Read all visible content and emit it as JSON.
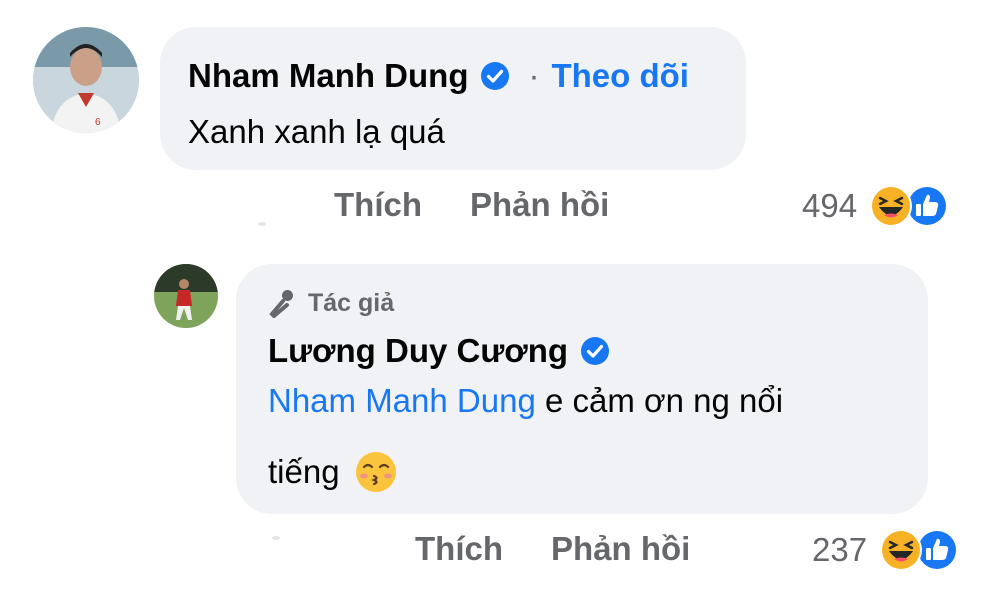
{
  "comment1": {
    "author": "Nham Manh Dung",
    "follow_sep": "·",
    "follow_label": "Theo dõi",
    "text": "Xanh xanh lạ quá",
    "actions": {
      "like": "Thích",
      "reply": "Phản hồi"
    },
    "reaction_count": "494",
    "reactions": [
      "haha-icon",
      "like-icon"
    ]
  },
  "comment2": {
    "author_badge": "Tác giả",
    "author": "Lương Duy Cương",
    "mention": "Nham Manh Dung",
    "text_line1": " e cảm ơn ng nổi",
    "text_line2": "tiếng",
    "emoji": "kissing-face-icon",
    "actions": {
      "like": "Thích",
      "reply": "Phản hồi"
    },
    "reaction_count": "237",
    "reactions": [
      "haha-icon",
      "like-icon"
    ]
  },
  "colors": {
    "link": "#1877f2",
    "bubble": "#f0f2f5",
    "muted": "#65676b",
    "reaction_yellow": "#f7b125"
  }
}
